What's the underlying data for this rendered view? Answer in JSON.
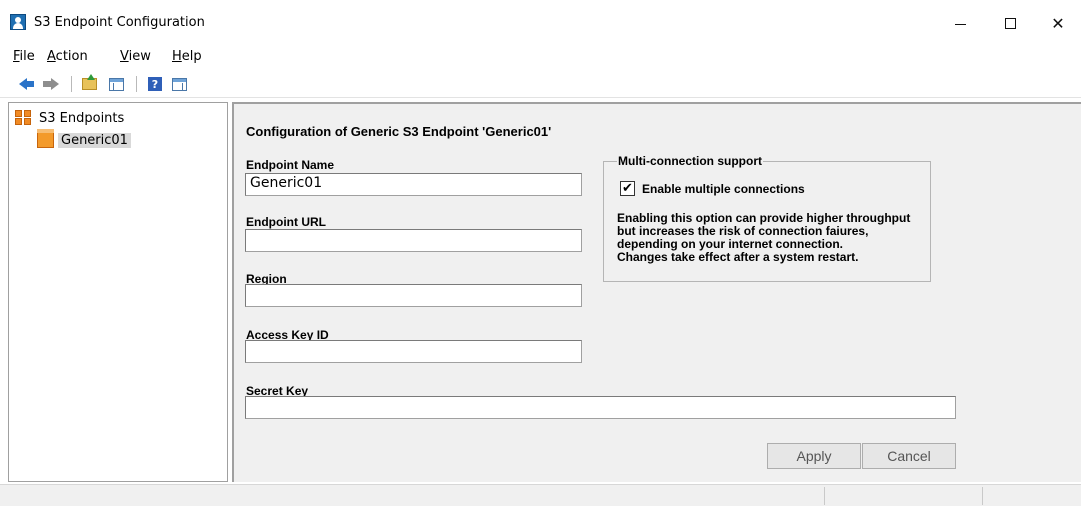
{
  "window": {
    "title": "S3 Endpoint Configuration",
    "icon": "user-app-icon",
    "controls": [
      "minimize-icon",
      "maximize-icon",
      "close-icon"
    ],
    "close_glyph": "✕"
  },
  "menu": {
    "file_rest": "ile",
    "file_acc": "F",
    "action_acc": "A",
    "action_rest": "ction",
    "view_acc": "V",
    "view_rest": "iew",
    "help_acc": "H",
    "help_rest": "elp"
  },
  "toolbar": {
    "buttons": [
      "back-arrow-icon",
      "forward-arrow-icon",
      "up-folder-icon",
      "show-hide-tree-icon",
      "help-icon",
      "action-pane-icon"
    ],
    "help_glyph": "?"
  },
  "tree": {
    "root_label": "S3 Endpoints",
    "child_label": "Generic01"
  },
  "config": {
    "title": "Configuration of Generic S3 Endpoint 'Generic01'",
    "endpoint_name_label": "Endpoint Name",
    "endpoint_name_value": "Generic01",
    "endpoint_url_label": "Endpoint URL",
    "endpoint_url_value": "",
    "region_label": "Region",
    "region_value": "",
    "access_key_label": "Access Key ID",
    "access_key_value": "",
    "secret_key_label": "Secret Key",
    "secret_key_value": "",
    "multiconn_legend": "Multi-connection support",
    "multiconn_checkbox_label": "Enable multiple connections",
    "multiconn_checked": true,
    "checkmark": "✔",
    "multiconn_info_1": "Enabling this option can provide higher throughput",
    "multiconn_info_2": "but increases the risk of connection faiures,",
    "multiconn_info_3": "depending on your internet connection.",
    "multiconn_info_4": "Changes take effect after a system restart.",
    "apply_label": "Apply",
    "cancel_label": "Cancel"
  }
}
